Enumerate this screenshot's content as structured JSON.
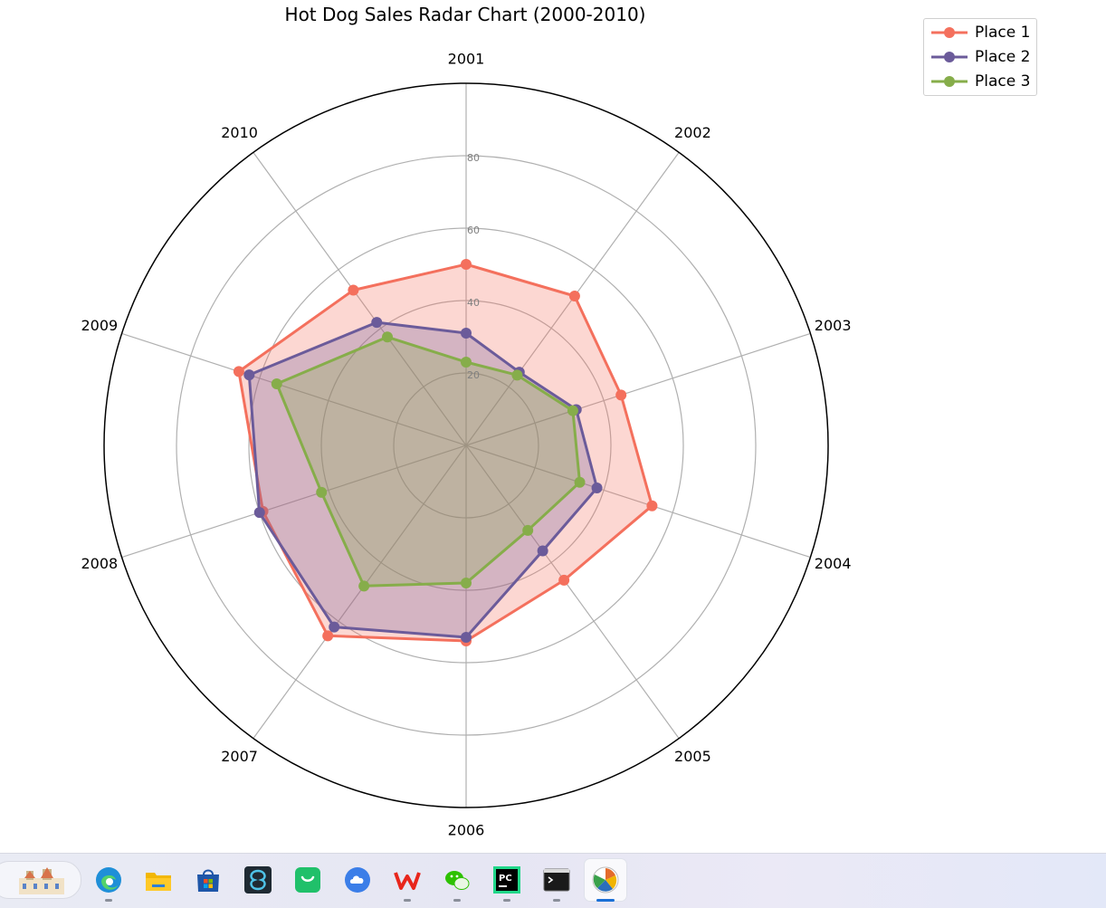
{
  "window": {
    "title": "Hot Dog Sales Radar Chart (2000-2010)"
  },
  "chart_data": {
    "type": "radar",
    "title": "Hot Dog Sales Radar Chart (2000-2010)",
    "categories": [
      "2001",
      "2002",
      "2003",
      "2004",
      "2005",
      "2006",
      "2007",
      "2008",
      "2009",
      "2010"
    ],
    "rlim": [
      0,
      100
    ],
    "rticks": [
      20,
      40,
      60,
      80
    ],
    "grid": true,
    "legend_position": "top-right",
    "series": [
      {
        "name": "Place 1",
        "color": "#f4705d",
        "values": [
          50,
          51,
          45,
          54,
          46,
          54,
          65,
          59,
          66,
          53
        ]
      },
      {
        "name": "Place 2",
        "color": "#6b5b9a",
        "values": [
          31,
          25,
          32,
          38,
          36,
          53,
          62,
          60,
          63,
          42
        ]
      },
      {
        "name": "Place 3",
        "color": "#86ad4a",
        "values": [
          23,
          24,
          31,
          33,
          29,
          38,
          48,
          42,
          55,
          37
        ]
      }
    ]
  },
  "taskbar": {
    "items": [
      {
        "name": "widgets",
        "icon": "weather-widget-icon"
      },
      {
        "name": "edge",
        "icon": "edge-browser-icon",
        "color": "#1f8fd8"
      },
      {
        "name": "file-explorer",
        "icon": "folder-icon",
        "color": "#f2b705"
      },
      {
        "name": "store",
        "icon": "store-icon",
        "color": "#1e56a8"
      },
      {
        "name": "app-dark",
        "icon": "swirl-app-icon",
        "color": "#1f2a33"
      },
      {
        "name": "app-green",
        "icon": "chat-green-icon",
        "color": "#20c06a"
      },
      {
        "name": "app-blue",
        "icon": "cloud-app-icon",
        "color": "#3b7ee8"
      },
      {
        "name": "wps",
        "icon": "wps-office-icon",
        "color": "#e8261c"
      },
      {
        "name": "wechat",
        "icon": "wechat-icon",
        "color": "#2dc100"
      },
      {
        "name": "pycharm",
        "icon": "pycharm-icon",
        "color": "#21d789"
      },
      {
        "name": "terminal",
        "icon": "terminal-icon",
        "color": "#1a1a1a"
      },
      {
        "name": "python-plot",
        "icon": "matplotlib-icon",
        "color": "#e46b2b"
      }
    ]
  }
}
